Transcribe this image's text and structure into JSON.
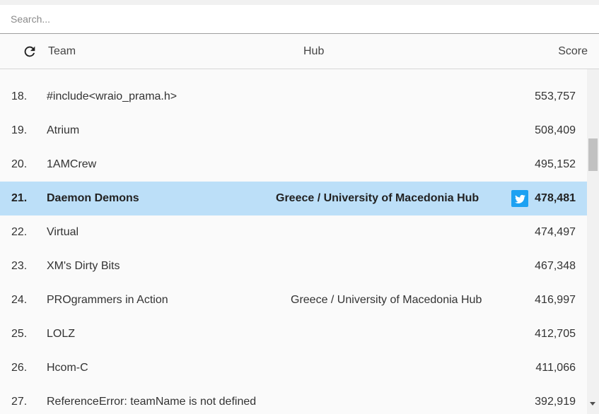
{
  "search": {
    "placeholder": "Search..."
  },
  "header": {
    "team": "Team",
    "hub": "Hub",
    "score": "Score"
  },
  "rows": [
    {
      "rank": "18.",
      "team": "#include<wraio_prama.h>",
      "hub": "",
      "score": "553,757"
    },
    {
      "rank": "19.",
      "team": "Atrium",
      "hub": "",
      "score": "508,409"
    },
    {
      "rank": "20.",
      "team": "1AMCrew",
      "hub": "",
      "score": "495,152"
    },
    {
      "rank": "21.",
      "team": "Daemon Demons",
      "hub": "Greece / University of Macedonia Hub",
      "score": "478,481",
      "highlighted": true,
      "twitter": true
    },
    {
      "rank": "22.",
      "team": "Virtual",
      "hub": "",
      "score": "474,497"
    },
    {
      "rank": "23.",
      "team": "XM's Dirty Bits",
      "hub": "",
      "score": "467,348"
    },
    {
      "rank": "24.",
      "team": "PROgrammers in Action",
      "hub": "Greece / University of Macedonia Hub",
      "score": "416,997"
    },
    {
      "rank": "25.",
      "team": "LOLZ",
      "hub": "",
      "score": "412,705"
    },
    {
      "rank": "26.",
      "team": "Hcom-C",
      "hub": "",
      "score": "411,066"
    },
    {
      "rank": "27.",
      "team": "ReferenceError: teamName is not defined",
      "hub": "",
      "score": "392,919"
    }
  ],
  "icons": {
    "refresh": "refresh-icon",
    "twitter": "twitter-icon"
  },
  "colors": {
    "highlight": "#bcdff8",
    "twitter": "#1da1f2"
  }
}
